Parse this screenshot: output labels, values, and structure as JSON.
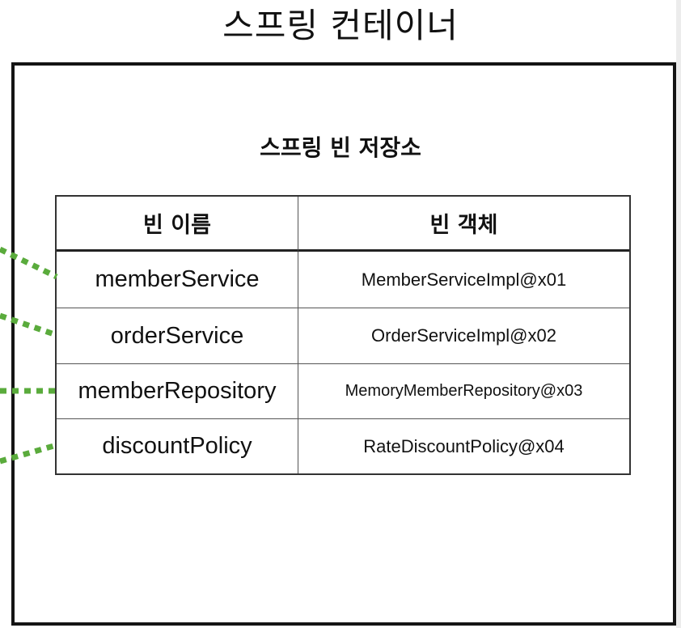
{
  "container": {
    "title": "스프링 컨테이너"
  },
  "repository": {
    "title": "스프링 빈 저장소",
    "headers": {
      "name": "빈 이름",
      "object": "빈 객체"
    },
    "rows": [
      {
        "name": "memberService",
        "object": "MemberServiceImpl@x01"
      },
      {
        "name": "orderService",
        "object": "OrderServiceImpl@x02"
      },
      {
        "name": "memberRepository",
        "object": "MemoryMemberRepository@x03"
      },
      {
        "name": "discountPolicy",
        "object": "RateDiscountPolicy@x04"
      }
    ]
  },
  "colors": {
    "connector": "#5aab3c",
    "border": "#141414"
  }
}
